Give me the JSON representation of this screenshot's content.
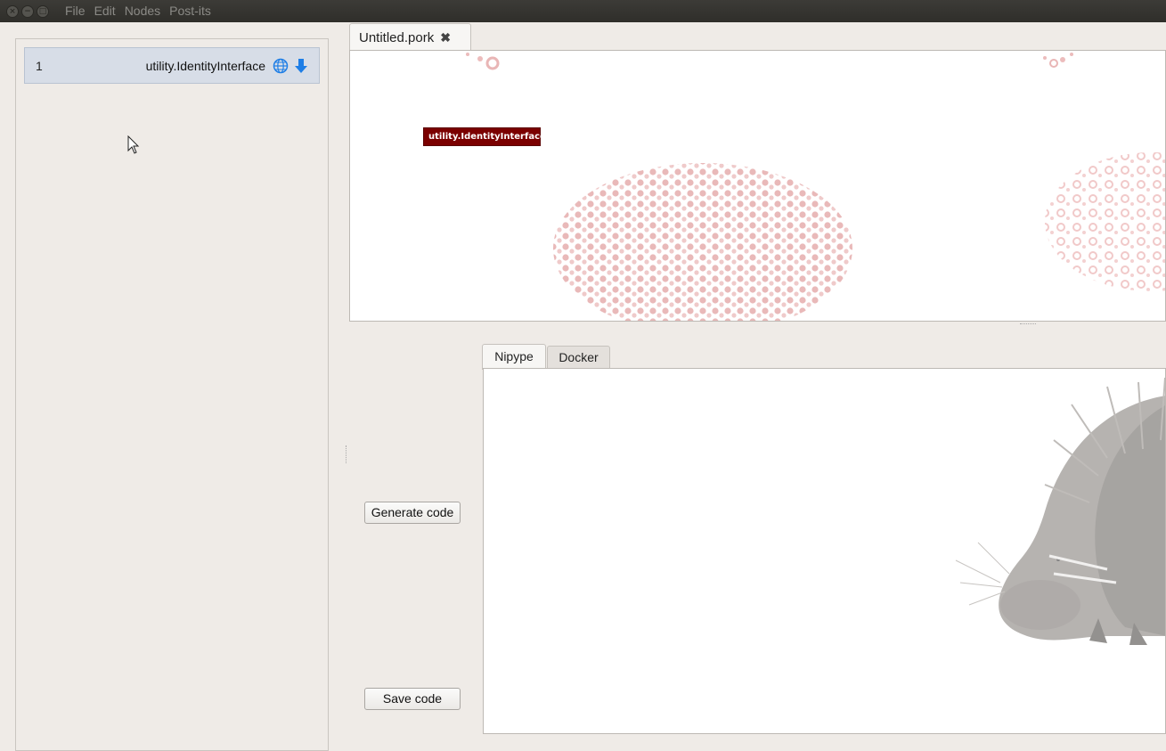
{
  "menubar": {
    "window_buttons": [
      "×",
      "−",
      "□"
    ],
    "menus": [
      "File",
      "Edit",
      "Nodes",
      "Post-its"
    ]
  },
  "node_list": {
    "items": [
      {
        "index": "1",
        "name": "utility.IdentityInterface",
        "icons": [
          "globe-icon",
          "download-arrow-icon"
        ]
      }
    ]
  },
  "file_tab": {
    "label": "Untitled.pork",
    "close_glyph": "✖"
  },
  "canvas": {
    "nodes": [
      {
        "label": "utility.IdentityInterface",
        "color": "#7b0000"
      }
    ]
  },
  "actions": {
    "generate_label": "Generate code",
    "save_label": "Save code"
  },
  "code_tabs": [
    {
      "label": "Nipype",
      "active": true
    },
    {
      "label": "Docker",
      "active": false
    }
  ],
  "colors": {
    "accent": "#1e7ee6",
    "node": "#7b0000",
    "selection": "#d7dde7"
  }
}
